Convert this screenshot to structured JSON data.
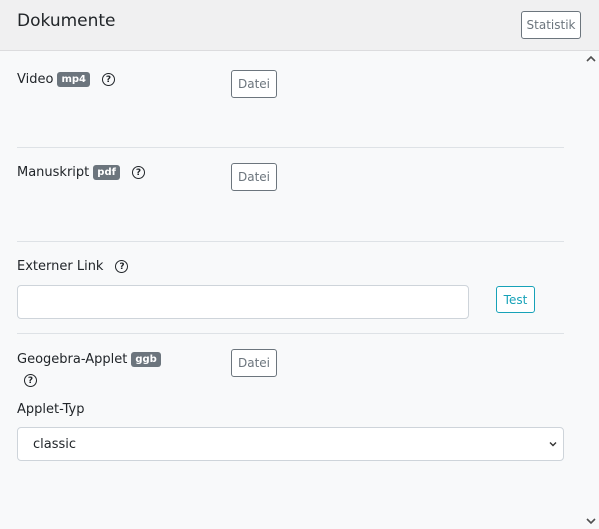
{
  "header": {
    "title": "Dokumente",
    "stat_button": "Statistik"
  },
  "video": {
    "label": "Video",
    "badge": "mp4",
    "help": "?",
    "button": "Datei"
  },
  "manuskript": {
    "label": "Manuskript",
    "badge": "pdf",
    "help": "?",
    "button": "Datei"
  },
  "link": {
    "label": "Externer Link",
    "help": "?",
    "value": "",
    "test_button": "Test"
  },
  "geogebra": {
    "label": "Geogebra-Applet",
    "badge": "ggb",
    "help": "?",
    "button": "Datei"
  },
  "applet_typ": {
    "label": "Applet-Typ",
    "selected": "classic"
  },
  "colors": {
    "accent": "#17a2b8",
    "badge": "#6c757d",
    "border": "#ced4da"
  }
}
